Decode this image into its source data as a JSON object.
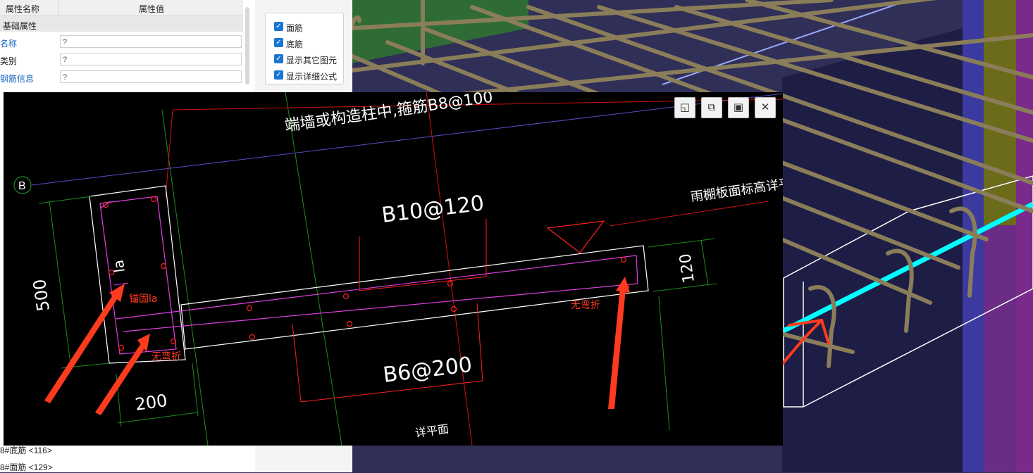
{
  "property_panel": {
    "col_name": "属性名称",
    "col_value": "属性值",
    "group": "基础属性",
    "rows": [
      {
        "name": "名称",
        "value": "?"
      },
      {
        "name": "类别",
        "value": "?"
      },
      {
        "name": "钢筋信息",
        "value": "?"
      }
    ],
    "rebar_items": [
      "8#底筋 <116>",
      "8#面筋 <129>"
    ]
  },
  "display_options": [
    {
      "label": "面筋",
      "checked": true
    },
    {
      "label": "底筋",
      "checked": true
    },
    {
      "label": "显示其它图元",
      "checked": true
    },
    {
      "label": "显示详细公式",
      "checked": true
    }
  ],
  "drawing": {
    "title_note": "端墙或构造柱中,箍筋B8@100",
    "axis_label": "B",
    "top_rebar": "B10@120",
    "bottom_rebar": "B6@200",
    "elevation_note": "雨棚板面标高详平面",
    "dim_height": "500",
    "dim_width": "200",
    "dim_thickness": "120",
    "bar_mark": "la",
    "ref_note": "详平面",
    "annotations": [
      "锚固la",
      "无弯折",
      "无弯折"
    ]
  },
  "toolbar_icons": [
    "restore-icon",
    "copy-icon",
    "save-icon",
    "close-icon"
  ],
  "colors": {
    "annotation_red": "#ff3b1f",
    "magenta_rebar": "#e040e0",
    "cyan_beam": "#00ffff"
  }
}
